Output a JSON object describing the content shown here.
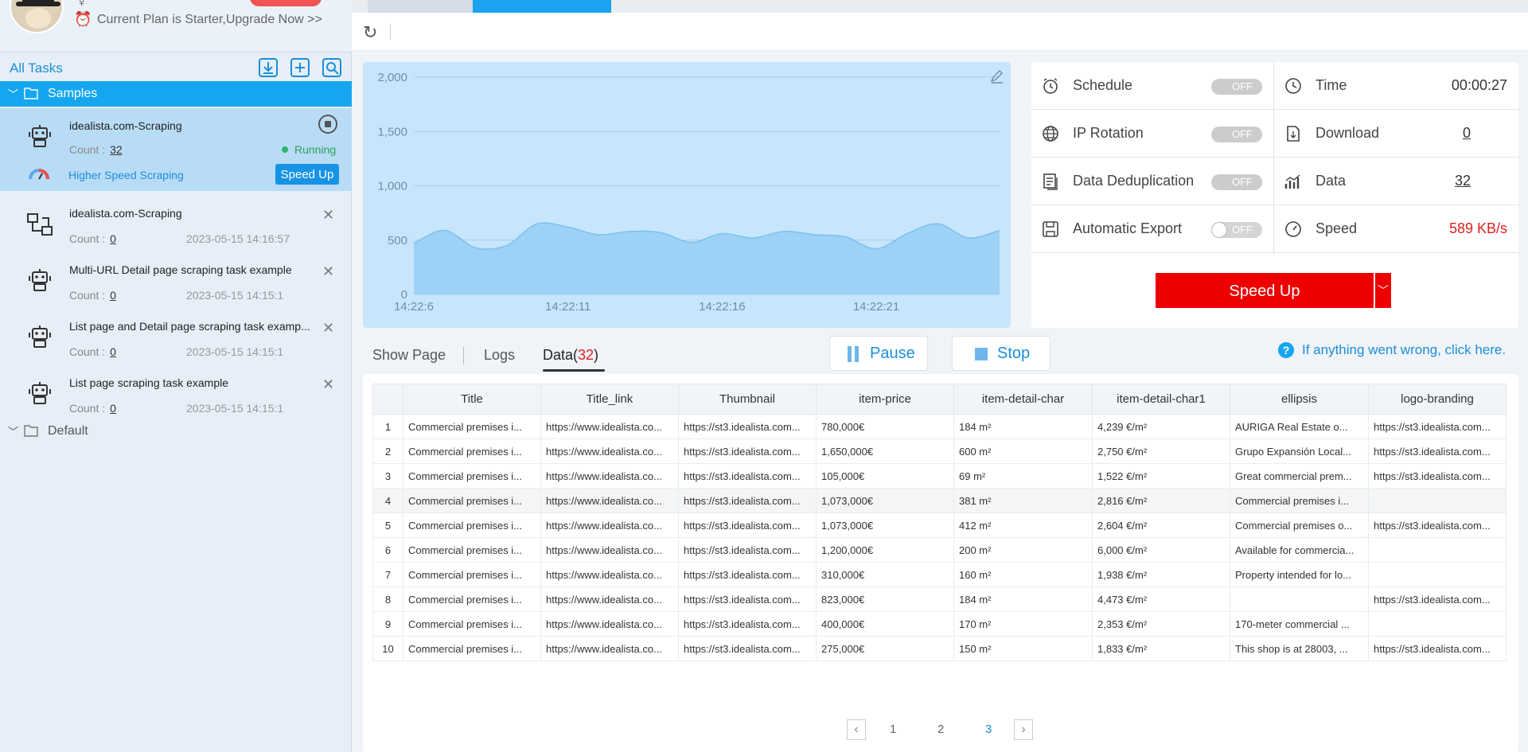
{
  "profile": {
    "plan_text": "Current Plan is Starter,Upgrade Now >>"
  },
  "sidebar": {
    "all_tasks": "All Tasks",
    "folders": {
      "samples": "Samples",
      "default": "Default"
    },
    "count_label": "Count :",
    "tasks": [
      {
        "name": "idealista.com-Scraping",
        "count": "32",
        "status": "Running",
        "speed_text": "Higher Speed Scraping",
        "speed_btn": "Speed Up"
      },
      {
        "name": "idealista.com-Scraping",
        "count": "0",
        "date": "2023-05-15 14:16:57"
      },
      {
        "name": "Multi-URL Detail page scraping task example",
        "count": "0",
        "date": "2023-05-15 14:15:1"
      },
      {
        "name": "List page and Detail page scraping task examp...",
        "count": "0",
        "date": "2023-05-15 14:15:1"
      },
      {
        "name": "List page scraping task example",
        "count": "0",
        "date": "2023-05-15 14:15:1"
      }
    ]
  },
  "chart_data": {
    "type": "area",
    "x": [
      "14:22:6",
      "14:22:7",
      "14:22:8",
      "14:22:9",
      "14:22:10",
      "14:22:11",
      "14:22:12",
      "14:22:13",
      "14:22:14",
      "14:22:15",
      "14:22:16",
      "14:22:17",
      "14:22:18",
      "14:22:19",
      "14:22:20",
      "14:22:21",
      "14:22:22",
      "14:22:23",
      "14:22:24",
      "14:22:25"
    ],
    "x_tick_labels": [
      "14:22:6",
      "14:22:11",
      "14:22:16",
      "14:22:21"
    ],
    "values": [
      470,
      590,
      430,
      450,
      650,
      620,
      550,
      580,
      570,
      480,
      560,
      520,
      580,
      550,
      530,
      420,
      560,
      650,
      520,
      590
    ],
    "y_ticks": [
      "0",
      "500",
      "1,000",
      "1,500",
      "2,000"
    ],
    "ylim": [
      0,
      2000
    ],
    "grid": true,
    "colors": {
      "fill": "#9dd1f5",
      "line": "#7cc0ef",
      "grid": "#a8cde9",
      "axis_text": "#6a8fae"
    }
  },
  "stats": {
    "schedule": {
      "label": "Schedule",
      "toggle": "OFF"
    },
    "ip_rotation": {
      "label": "IP Rotation",
      "toggle": "OFF"
    },
    "dedup": {
      "label": "Data Deduplication",
      "toggle": "OFF"
    },
    "auto_export": {
      "label": "Automatic Export",
      "toggle": "OFF"
    },
    "time": {
      "label": "Time",
      "value": "00:00:27"
    },
    "download": {
      "label": "Download",
      "value": "0"
    },
    "data": {
      "label": "Data",
      "value": "32"
    },
    "speed": {
      "label": "Speed",
      "value": "589 KB/s"
    },
    "speed_up_btn": "Speed Up"
  },
  "tabs": {
    "show_page": "Show Page",
    "logs": "Logs",
    "data": "Data(",
    "data_count": "32",
    "data_close": ")"
  },
  "controls": {
    "pause": "Pause",
    "stop": "Stop",
    "help": "If anything went wrong, click here."
  },
  "table": {
    "columns": [
      "",
      "Title",
      "Title_link",
      "Thumbnail",
      "item-price",
      "item-detail-char",
      "item-detail-char1",
      "ellipsis",
      "logo-branding"
    ],
    "rows": [
      [
        "1",
        "Commercial premises i...",
        "https://www.idealista.co...",
        "https://st3.idealista.com...",
        "780,000€",
        "184 m²",
        "4,239 €/m²",
        "AURIGA Real Estate o...",
        "https://st3.idealista.com..."
      ],
      [
        "2",
        "Commercial premises i...",
        "https://www.idealista.co...",
        "https://st3.idealista.com...",
        "1,650,000€",
        "600 m²",
        "2,750 €/m²",
        "Grupo Expansión Local...",
        "https://st3.idealista.com..."
      ],
      [
        "3",
        "Commercial premises i...",
        "https://www.idealista.co...",
        "https://st3.idealista.com...",
        "105,000€",
        "69 m²",
        "1,522 €/m²",
        "Great commercial prem...",
        "https://st3.idealista.com..."
      ],
      [
        "4",
        "Commercial premises i...",
        "https://www.idealista.co...",
        "https://st3.idealista.com...",
        "1,073,000€",
        "381 m²",
        "2,816 €/m²",
        "Commercial premises i...",
        ""
      ],
      [
        "5",
        "Commercial premises i...",
        "https://www.idealista.co...",
        "https://st3.idealista.com...",
        "1,073,000€",
        "412 m²",
        "2,604 €/m²",
        "Commercial premises o...",
        "https://st3.idealista.com..."
      ],
      [
        "6",
        "Commercial premises i...",
        "https://www.idealista.co...",
        "https://st3.idealista.com...",
        "1,200,000€",
        "200 m²",
        "6,000 €/m²",
        "Available for commercia...",
        ""
      ],
      [
        "7",
        "Commercial premises i...",
        "https://www.idealista.co...",
        "https://st3.idealista.com...",
        "310,000€",
        "160 m²",
        "1,938 €/m²",
        "Property intended for lo...",
        ""
      ],
      [
        "8",
        "Commercial premises i...",
        "https://www.idealista.co...",
        "https://st3.idealista.com...",
        "823,000€",
        "184 m²",
        "4,473 €/m²",
        "",
        "https://st3.idealista.com..."
      ],
      [
        "9",
        "Commercial premises i...",
        "https://www.idealista.co...",
        "https://st3.idealista.com...",
        "400,000€",
        "170 m²",
        "2,353 €/m²",
        "170-meter commercial ...",
        ""
      ],
      [
        "10",
        "Commercial premises i...",
        "https://www.idealista.co...",
        "https://st3.idealista.com...",
        "275,000€",
        "150 m²",
        "1,833 €/m²",
        "This shop is at 28003, ...",
        "https://st3.idealista.com..."
      ]
    ]
  },
  "pager": {
    "pages": [
      "1",
      "2",
      "3"
    ],
    "active": "3"
  }
}
